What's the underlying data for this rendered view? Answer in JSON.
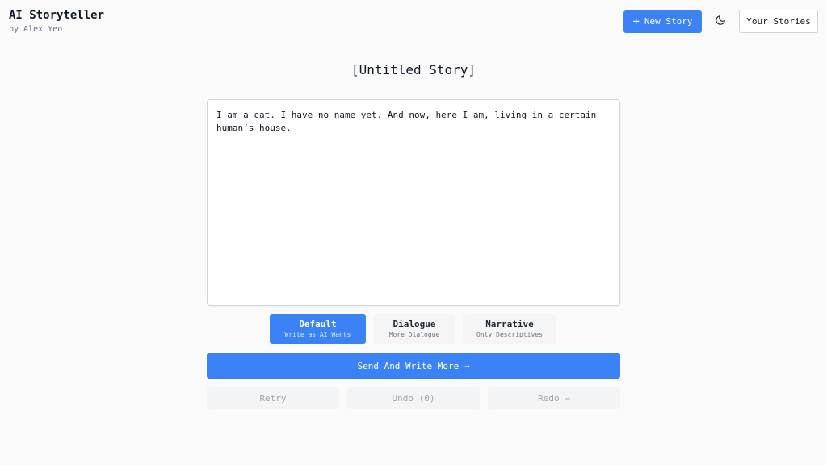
{
  "header": {
    "app_title": "AI Storyteller",
    "byline": "by Alex Yeo",
    "new_story_label": "New Story",
    "your_stories_label": "Your Stories",
    "theme_icon": "moon-icon"
  },
  "story": {
    "title": "[Untitled Story]",
    "text": "I am a cat. I have no name yet. And now, here I am, living in a certain human’s house."
  },
  "modes": [
    {
      "label": "Default",
      "sub": "Write as AI Wants",
      "active": true
    },
    {
      "label": "Dialogue",
      "sub": "More Dialogue",
      "active": false
    },
    {
      "label": "Narrative",
      "sub": "Only Descriptives",
      "active": false
    }
  ],
  "actions": {
    "send_label": "Send And Write More →",
    "retry_label": "Retry",
    "undo_label": "Undo (0)",
    "redo_label": "Redo →"
  },
  "colors": {
    "accent": "#3b82f6",
    "background": "#fafafa"
  }
}
